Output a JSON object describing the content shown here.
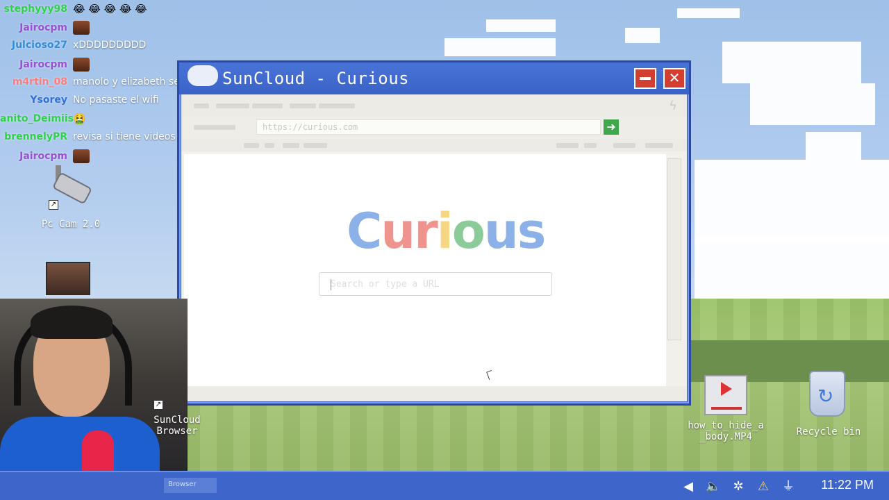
{
  "chat": [
    {
      "user": "stephyyy98",
      "color": "#2ed14a",
      "message": "",
      "emoji": "😂 😂 😂 😂 😂"
    },
    {
      "user": "Jairocpm",
      "color": "#9b4fd6",
      "message": "",
      "emote": true
    },
    {
      "user": "Julcioso27",
      "color": "#2f8dde",
      "message": "xDDDDDDDDD"
    },
    {
      "user": "Jairocpm",
      "color": "#9b4fd6",
      "message": "",
      "emote": true
    },
    {
      "user": "m4rtin_08",
      "color": "#ff6b6b",
      "message": "manolo y elizabeth se juntan"
    },
    {
      "user": "Ysorey",
      "color": "#2f6fe0",
      "message": "No pasaste el wifi"
    },
    {
      "user": "anito_Deimiis",
      "color": "#2ed14a",
      "message": "",
      "emoji": "🤮"
    },
    {
      "user": "brennelyPR",
      "color": "#2ed14a",
      "message": "revisa si tiene videos guardados?"
    },
    {
      "user": "Jairocpm",
      "color": "#9b4fd6",
      "message": "",
      "emote": true
    }
  ],
  "desktop": {
    "pc_cam_label": "Pc Cam 2.0",
    "browser_label_1": "SunCloud",
    "browser_label_2": "Browser",
    "video_label_1": "how_to_hide_a",
    "video_label_2": "_body.MP4",
    "recycle_label": "Recycle bin"
  },
  "window": {
    "title": "SunCloud - Curious",
    "minimize_label": "",
    "close_label": "✕",
    "address": "https://curious.com",
    "go_label": "➜"
  },
  "page": {
    "logo_letters": [
      {
        "ch": "C",
        "color": "#2f72d8"
      },
      {
        "ch": "u",
        "color": "#e23b32"
      },
      {
        "ch": "r",
        "color": "#e23b32"
      },
      {
        "ch": "i",
        "color": "#f2b51e"
      },
      {
        "ch": "o",
        "color": "#2ea247"
      },
      {
        "ch": "u",
        "color": "#2f72d8"
      },
      {
        "ch": "s",
        "color": "#2f72d8"
      }
    ],
    "search_placeholder": "Search or type a URL"
  },
  "taskbar": {
    "task_label": "Browser",
    "clock": "11:22 PM",
    "tray": [
      "chevron-left",
      "speaker",
      "network",
      "warning",
      "usb"
    ]
  }
}
